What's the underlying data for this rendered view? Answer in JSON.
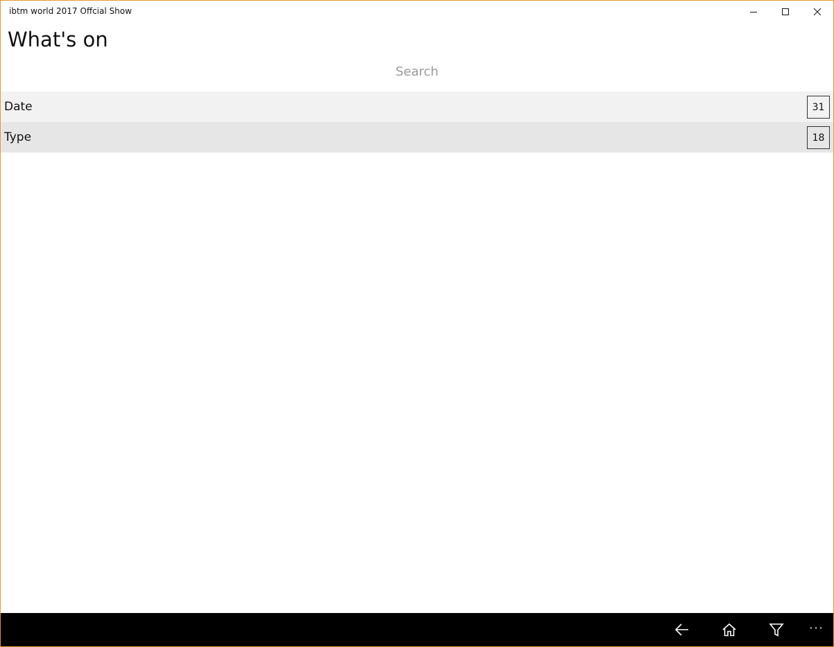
{
  "window": {
    "title": "ibtm world 2017 Offcial Show"
  },
  "page": {
    "title": "What's on"
  },
  "search": {
    "placeholder": "Search",
    "value": ""
  },
  "filters": [
    {
      "label": "Date",
      "count": "31"
    },
    {
      "label": "Type",
      "count": "18"
    }
  ],
  "appbar": {
    "icons": [
      "back-arrow-icon",
      "home-icon",
      "filter-icon",
      "more-icon"
    ],
    "more_label": "···"
  },
  "colors": {
    "window_border": "#e2973a",
    "appbar_background": "#000000",
    "row_date_background": "#f2f2f2",
    "row_type_background": "#e6e6e6"
  }
}
